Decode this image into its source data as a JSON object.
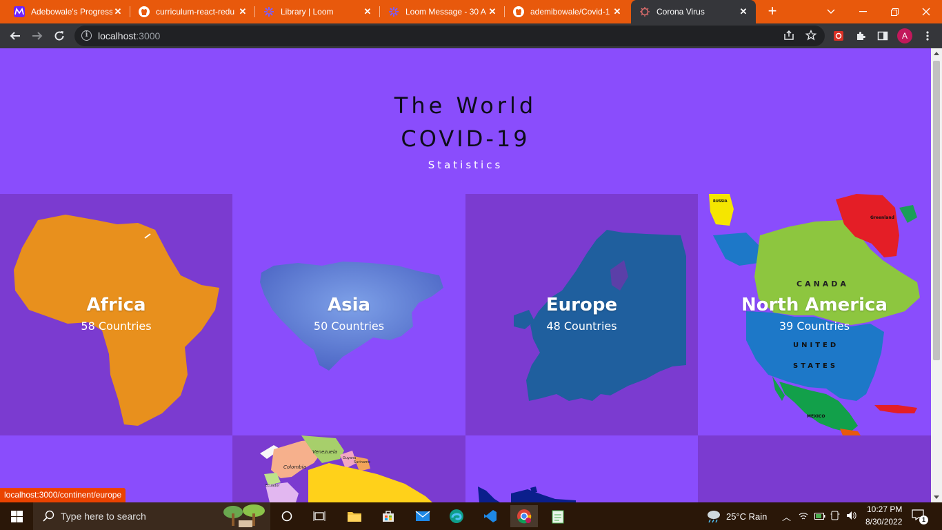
{
  "browser": {
    "tabs": [
      {
        "title": "Adebowale's Progress",
        "icon": "microverse-icon",
        "active": false
      },
      {
        "title": "curriculum-react-redu",
        "icon": "github-icon",
        "active": false
      },
      {
        "title": "Library | Loom",
        "icon": "loom-icon",
        "active": false
      },
      {
        "title": "Loom Message - 30 A",
        "icon": "loom-icon",
        "active": false
      },
      {
        "title": "ademibowale/Covid-1",
        "icon": "github-icon",
        "active": false
      },
      {
        "title": "Corona Virus",
        "icon": "virus-icon",
        "active": true
      }
    ],
    "url": {
      "host": "localhost",
      "port": ":3000"
    },
    "profile_initial": "A",
    "hover_link": "localhost:3000/continent/europe"
  },
  "hero": {
    "line1": "The World",
    "line2": "COVID-19",
    "line3": "Statistics"
  },
  "continents": [
    {
      "name": "Africa",
      "count": "58 Countries",
      "map_color": "#e8901d"
    },
    {
      "name": "Asia",
      "count": "50 Countries",
      "map_color": "#5a7fd0"
    },
    {
      "name": "Europe",
      "count": "48 Countries",
      "map_color": "#1f5f9e"
    },
    {
      "name": "North America",
      "count": "39 Countries",
      "map_color": "#1d78c8"
    }
  ],
  "map_labels": {
    "north_america": {
      "canada": "CANADA",
      "united": "UNITED",
      "states": "STATES",
      "mexico": "MEXICO",
      "greenland": "Greenland",
      "russia": "RUSSIA"
    },
    "south_america": {
      "venezuela": "Venezuela",
      "colombia": "Colombia",
      "ecuador": "Ecuador",
      "guyana": "Guyana",
      "suriname": "Suriname"
    }
  },
  "colors": {
    "page_bg": "#8a4dfc",
    "tile_dark": "#7b3bd0",
    "tab_strip": "#e8590c",
    "toolbar": "#35363a",
    "taskbar": "#2a1708"
  },
  "taskbar": {
    "search_placeholder": "Type here to search",
    "weather": "25°C  Rain",
    "time": "10:27 PM",
    "date": "8/30/2022",
    "notification_count": "1"
  }
}
